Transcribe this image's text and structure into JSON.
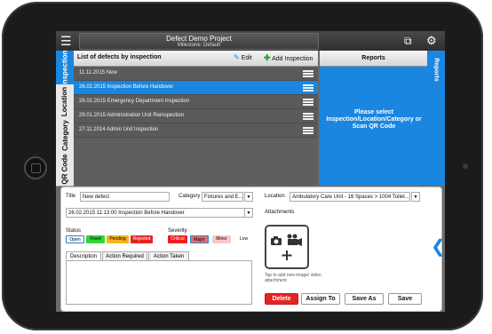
{
  "app": {
    "project_title": "Defect Demo Project",
    "milestone": "Milestone: Default"
  },
  "side_tabs": [
    "Inspection",
    "Location",
    "Category",
    "QR Code"
  ],
  "list": {
    "header": "List of defects by inspection",
    "edit_label": "Edit",
    "add_label": "Add Inspection",
    "rows": [
      "11.11.2015  New",
      "26.02.2015  Inspection Before Handover",
      "26.02.2015  Emergency Department Inspection",
      "29.01.2015  Administration Unit Reinspection",
      "27.11.2014  Admin Unit Inspection"
    ],
    "selected_index": 1
  },
  "reports": {
    "header": "Reports",
    "message": "Please select Inspection/Location/Category or Scan QR Code",
    "tab_label": "Reports"
  },
  "detail": {
    "title_label": "Title",
    "title_value": "New defect",
    "category_label": "Category",
    "category_value": "Fixtures and E...",
    "location_label": "Location",
    "location_value": "Ambulatory Care Unit - 16 Spaces > 1004 Toilet...",
    "inspection_value": "26.02.2015 11:13:00 Inspection Before Handover",
    "attachments_label": "Attachments",
    "attachments_hint": "Tap to add new image/ video attachment",
    "status_label": "Status",
    "status_options": [
      "Open",
      "Fixed",
      "Pending",
      "Rejected"
    ],
    "severity_label": "Severity",
    "severity_options": [
      "Critical",
      "Major",
      "Minor",
      "Low"
    ],
    "text_tabs": [
      "Description",
      "Action Required",
      "Action Taken"
    ],
    "buttons": {
      "delete": "Delete",
      "assign": "Assign To",
      "save_as": "Save As",
      "save": "Save"
    }
  },
  "colors": {
    "accent": "#1a86e0",
    "delete": "#e52525",
    "status_fixed": "#35d435",
    "status_pending": "#f2b420",
    "status_rejected": "#e52525",
    "severity_critical": "#f01e1e",
    "severity_major": "#f06a6a",
    "severity_minor": "#f8c8c8"
  },
  "icons": [
    "menu-icon",
    "qr-scan-icon",
    "gear-icon",
    "pencil-icon",
    "plus-icon",
    "hamburger-icon",
    "camera-icon",
    "video-camera-icon",
    "plus-icon",
    "chevron-left-icon"
  ]
}
